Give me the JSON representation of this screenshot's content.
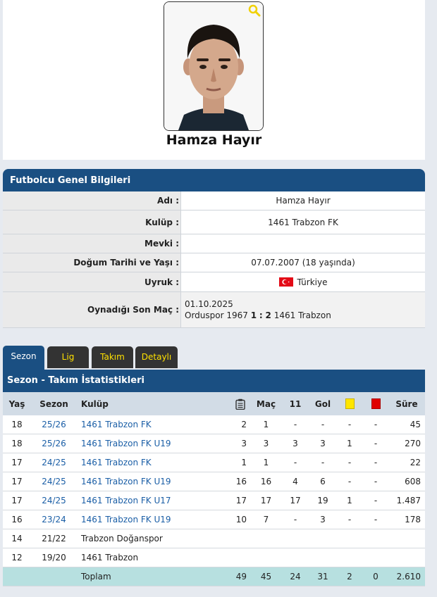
{
  "player": {
    "name": "Hamza Hayır"
  },
  "info": {
    "header": "Futbolcu Genel Bilgileri",
    "rows": {
      "name_label": "Adı :",
      "name_value": "Hamza Hayır",
      "club_label": "Kulüp :",
      "club_value": "1461 Trabzon FK",
      "position_label": "Mevki :",
      "position_value": "",
      "birth_label": "Doğum Tarihi ve Yaşı :",
      "birth_value": "07.07.2007 (18 yaşında)",
      "nation_label": "Uyruk :",
      "nation_value": "Türkiye",
      "lastmatch_label": "Oynadığı Son Maç :",
      "lastmatch_date": "01.10.2025",
      "lastmatch_home": "Orduspor 1967",
      "lastmatch_score_home": "1",
      "lastmatch_sep": ":",
      "lastmatch_score_away": "2",
      "lastmatch_away": "1461 Trabzon"
    }
  },
  "tabs": [
    "Sezon",
    "Lig",
    "Takım",
    "Detaylı"
  ],
  "stats": {
    "title": "Sezon - Takım İstatistikleri",
    "headers": {
      "age": "Yaş",
      "season": "Sezon",
      "club": "Kulüp",
      "matches": "Maç",
      "eleven": "11",
      "goals": "Gol",
      "minutes": "Süre"
    },
    "rows": [
      [
        "18",
        "25/26",
        "1461 Trabzon FK",
        "2",
        "1",
        "-",
        "-",
        "-",
        "-",
        "45"
      ],
      [
        "18",
        "25/26",
        "1461 Trabzon FK U19",
        "3",
        "3",
        "3",
        "3",
        "1",
        "-",
        "270"
      ],
      [
        "17",
        "24/25",
        "1461 Trabzon FK",
        "1",
        "1",
        "-",
        "-",
        "-",
        "-",
        "22"
      ],
      [
        "17",
        "24/25",
        "1461 Trabzon FK U19",
        "16",
        "16",
        "4",
        "6",
        "-",
        "-",
        "608"
      ],
      [
        "17",
        "24/25",
        "1461 Trabzon FK U17",
        "17",
        "17",
        "17",
        "19",
        "1",
        "-",
        "1.487"
      ],
      [
        "16",
        "23/24",
        "1461 Trabzon FK U19",
        "10",
        "7",
        "-",
        "3",
        "-",
        "-",
        "178"
      ],
      [
        "14",
        "21/22",
        "Trabzon Doğanspor",
        "",
        "",
        "",
        "",
        "",
        "",
        ""
      ],
      [
        "12",
        "19/20",
        "1461 Trabzon",
        "",
        "",
        "",
        "",
        "",
        "",
        ""
      ]
    ],
    "linked_rows": [
      true,
      true,
      true,
      true,
      true,
      true,
      false,
      false
    ],
    "total": [
      "Toplam",
      "49",
      "45",
      "24",
      "31",
      "2",
      "0",
      "2.610"
    ]
  },
  "colors": {
    "header_blue": "#1a4f82",
    "tab_text": "#ffe100",
    "link": "#1a5ea6",
    "total_row": "#b7e0e0"
  }
}
